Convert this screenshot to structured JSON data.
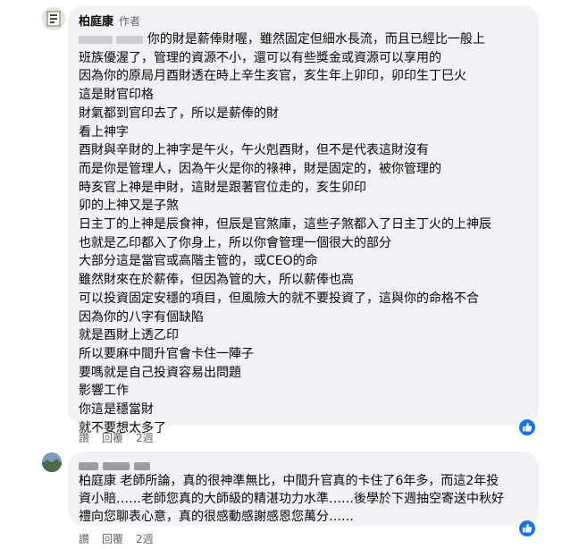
{
  "comment1": {
    "author": "柏庭康",
    "badge": "作者",
    "lines": [
      "你的財是薪俸財喔，雖然固定但細水長流，而且已經比一般上",
      "班族優渥了，管理的資源不小，還可以有些獎金或資源可以享用的",
      "因為你的原局月酉財透在時上辛生亥官，亥生年上卯印，卯印生丁巳火",
      "這是財官印格",
      "財氣都到官印去了，所以是薪俸的財",
      "看上神字",
      "酉財與辛財的上神字是午火，午火剋酉財，但不是代表這財沒有",
      "而是你是管理人，因為午火是你的祿神，財是固定的，被你管理的",
      "時亥官上神是申財，這財是跟著官位走的，亥生卯印",
      "卯的上神又是子煞",
      "日主丁的上神是辰食神，但辰是官煞庫，這些子煞都入了日主丁火的上神辰",
      "也就是乙印都入了你身上，所以你會管理一個很大的部分",
      "大部分這是當官或高階主管的，或CEO的命",
      "雖然財來在於薪俸，但因為管的大，所以薪俸也高",
      "可以投資固定安穩的項目，但風險大的就不要投資了，這與你的命格不合",
      "因為你的八字有個缺陷",
      "就是酉財上透乙印",
      "所以要麻中間升官會卡住一陣子",
      "要嗎就是自己投資容易出問題",
      "影響工作",
      "你這是穩當財",
      "就不要想太多了"
    ],
    "actions": {
      "like": "讚",
      "reply": "回覆",
      "time": "2週"
    }
  },
  "comment2": {
    "lines": [
      "柏庭康 老師所論，真的很神準無比，中間升官真的卡住了6年多，而這2年投",
      "資小賠……老師您真的大師級的精湛功力水準……後學於下週抽空寄送中秋好",
      "禮向您聊表心意，真的很感動感謝感恩您萬分……"
    ],
    "actions": {
      "like": "讚",
      "reply": "回覆",
      "time": "2週"
    }
  },
  "colors": {
    "like_badge": "#1b74e4",
    "bubble": "#f0f2f5",
    "meta": "#65676b"
  }
}
